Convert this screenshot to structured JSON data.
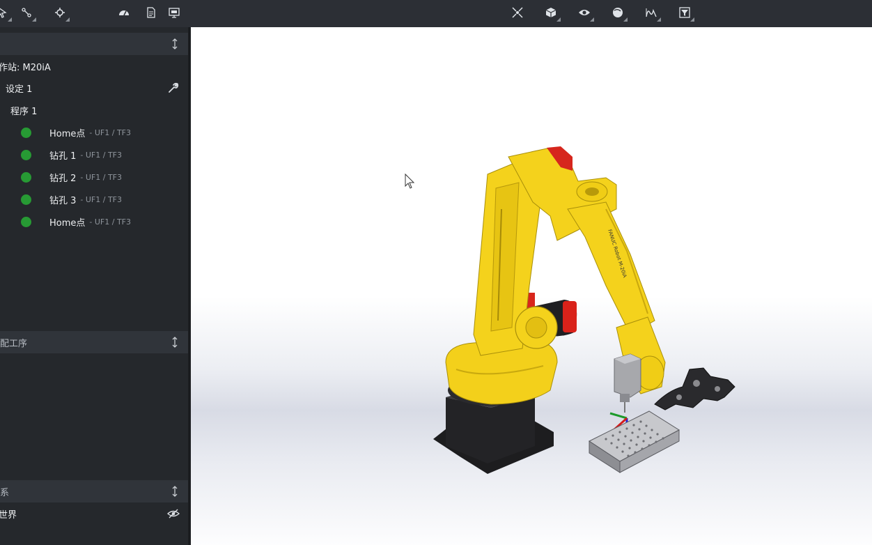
{
  "toolbar": {
    "left_icons": [
      "pointer-icon",
      "path-icon",
      "robot-icon",
      "gauge-icon",
      "document-icon",
      "monitor-icon"
    ],
    "right_icons": [
      "fit-view-icon",
      "cube-view-icon",
      "visibility-eye-icon",
      "render-sphere-icon",
      "path-curve-icon",
      "filter-icon"
    ]
  },
  "tree": {
    "header_title": "",
    "station": "作站: M20iA",
    "setup": "设定 1",
    "program": "程序 1",
    "targets": [
      {
        "name": "Home点",
        "frame": "- UF1 / TF3",
        "status_color": "#279a34"
      },
      {
        "name": "钻孔 1",
        "frame": "- UF1 / TF3",
        "status_color": "#279a34"
      },
      {
        "name": "钻孔 2",
        "frame": "- UF1 / TF3",
        "status_color": "#279a34"
      },
      {
        "name": "钻孔 3",
        "frame": "- UF1 / TF3",
        "status_color": "#279a34"
      },
      {
        "name": "Home点",
        "frame": "- UF1 / TF3",
        "status_color": "#279a34"
      }
    ]
  },
  "assembly": {
    "title": "配工序"
  },
  "frames": {
    "title": "系",
    "world": "世界"
  },
  "robot": {
    "arm_label": "FANUC Robot M-20iA"
  },
  "colors": {
    "robot_yellow": "#f4d21c",
    "status_green": "#279a34",
    "panel_bg": "#25282c"
  }
}
